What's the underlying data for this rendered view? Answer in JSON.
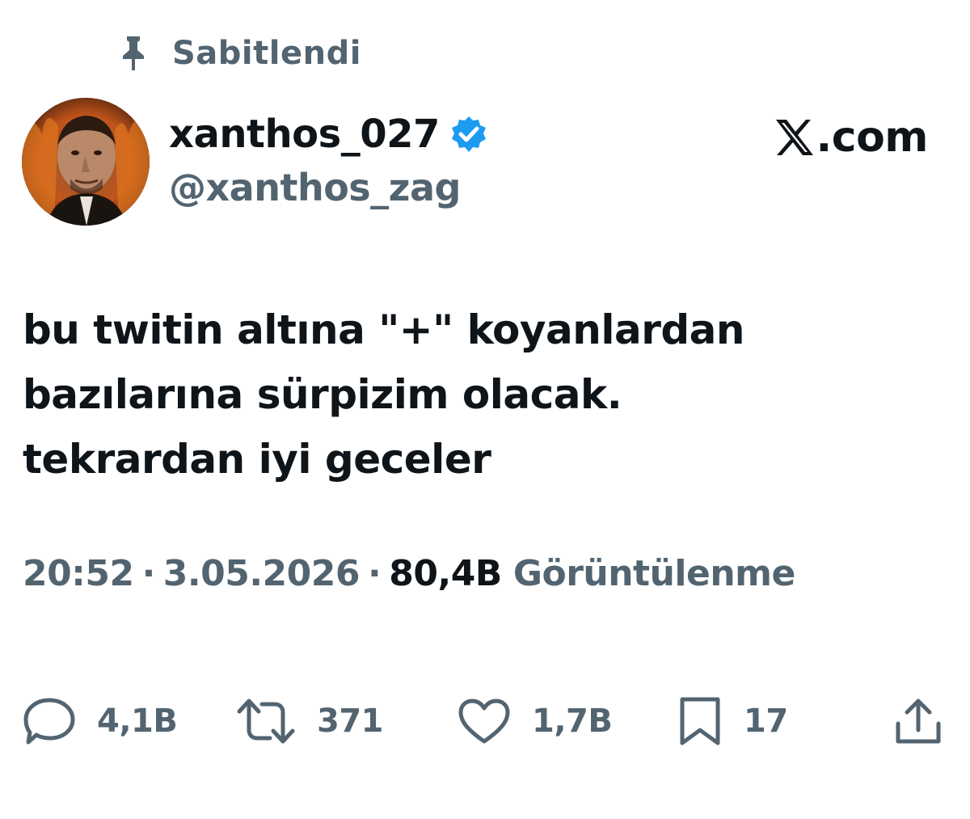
{
  "pinned": {
    "label": "Sabitlendi",
    "icon": "pin-icon"
  },
  "author": {
    "display_name": "xanthos_027",
    "handle": "@xanthos_zag",
    "verified": true,
    "verified_color": "#1d9bf0"
  },
  "brand": {
    "text": ".com",
    "icon": "x-logo-icon"
  },
  "tweet": {
    "lines": [
      "bu twitin altına \"+\" koyanlardan",
      "bazılarına sürpizim olacak.",
      "tekrardan iyi geceler"
    ]
  },
  "meta": {
    "time": "20:52",
    "separator": "·",
    "date": "3.05.2026",
    "views_count": "80,4B",
    "views_label": "Görüntülenme"
  },
  "actions": {
    "reply": {
      "icon": "reply-icon",
      "count": "4,1B"
    },
    "repost": {
      "icon": "repost-icon",
      "count": "371"
    },
    "like": {
      "icon": "heart-icon",
      "count": "1,7B"
    },
    "bookmark": {
      "icon": "bookmark-icon",
      "count": "17"
    },
    "share": {
      "icon": "share-icon"
    }
  },
  "colors": {
    "text_primary": "#0f1419",
    "text_secondary": "#536471",
    "accent": "#1d9bf0"
  }
}
